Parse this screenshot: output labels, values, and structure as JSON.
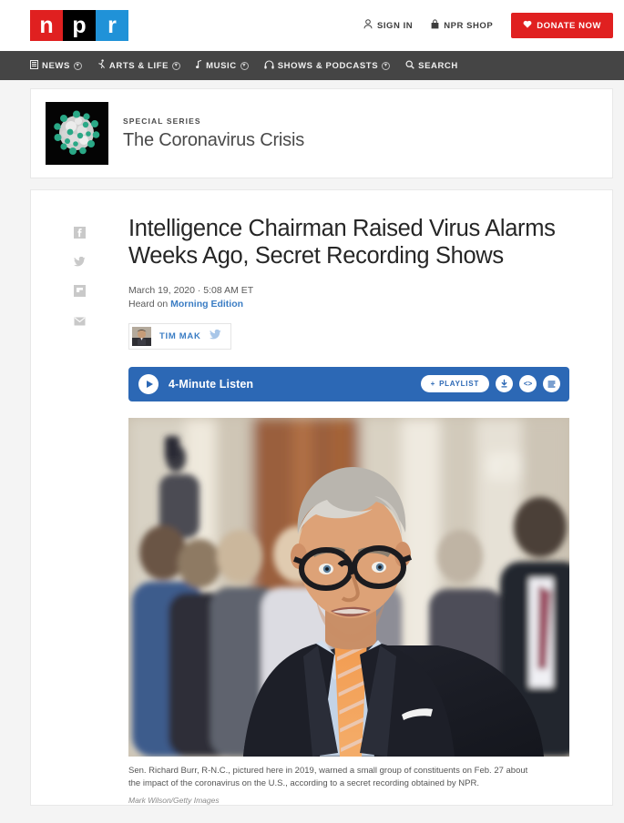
{
  "header": {
    "logo_letters": [
      "n",
      "p",
      "r"
    ],
    "sign_in": "SIGN IN",
    "shop": "NPR SHOP",
    "donate": "DONATE NOW"
  },
  "nav": {
    "items": [
      {
        "label": "NEWS",
        "has_caret": true
      },
      {
        "label": "ARTS & LIFE",
        "has_caret": true
      },
      {
        "label": "MUSIC",
        "has_caret": true
      },
      {
        "label": "SHOWS & PODCASTS",
        "has_caret": true
      },
      {
        "label": "SEARCH",
        "has_caret": false
      }
    ]
  },
  "series": {
    "eyebrow": "SPECIAL SERIES",
    "title": "The Coronavirus Crisis"
  },
  "article": {
    "headline": "Intelligence Chairman Raised Virus Alarms Weeks Ago, Secret Recording Shows",
    "date": "March 19, 2020 · 5:08 AM ET",
    "heard_on_prefix": "Heard on ",
    "heard_on_program": "Morning Edition",
    "author": "TIM MAK"
  },
  "audio": {
    "title": "4-Minute Listen",
    "playlist": "PLAYLIST",
    "playlist_plus": "+",
    "embed_glyph": "<>"
  },
  "photo": {
    "caption": "Sen. Richard Burr, R-N.C., pictured here in 2019, warned a small group of constituents on Feb. 27 about the impact of the coronavirus on the U.S., according to a secret recording obtained by NPR.",
    "credit": "Mark Wilson/Getty Images"
  },
  "share": {
    "items": [
      "facebook-icon",
      "twitter-icon",
      "flipboard-icon",
      "email-icon"
    ]
  },
  "colors": {
    "npr_red": "#e02020",
    "npr_blue": "#2092d8",
    "nav_gray": "#454545",
    "audio_blue": "#2c68b5",
    "link_blue": "#3b7dc4",
    "page_bg": "#f4f4f4"
  }
}
